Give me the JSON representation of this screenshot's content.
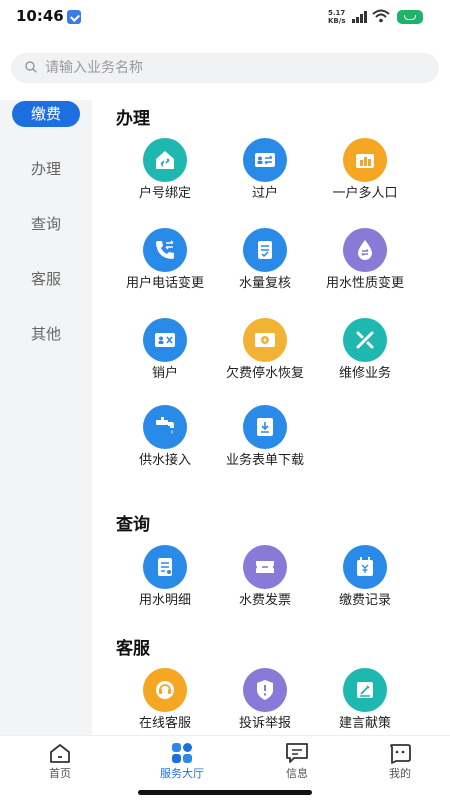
{
  "status_bar": {
    "time": "10:46",
    "speed_top": "5.17",
    "speed_bottom": "KB/s"
  },
  "search": {
    "placeholder": "请输入业务名称"
  },
  "sidebar": {
    "items": [
      {
        "label": "缴费",
        "active": true
      },
      {
        "label": "办理"
      },
      {
        "label": "查询"
      },
      {
        "label": "客服"
      },
      {
        "label": "其他"
      }
    ]
  },
  "sections": {
    "handle": {
      "title": "办理",
      "items": [
        {
          "label": "户号绑定",
          "icon": "house-link-icon",
          "color": "#1fb8b0"
        },
        {
          "label": "过户",
          "icon": "id-transfer-icon",
          "color": "#2a8ae8"
        },
        {
          "label": "一户多人口",
          "icon": "household-members-icon",
          "color": "#f5a623"
        },
        {
          "label": "用户电话变更",
          "icon": "phone-change-icon",
          "color": "#2a8ae8"
        },
        {
          "label": "水量复核",
          "icon": "water-review-icon",
          "color": "#2a8ae8"
        },
        {
          "label": "用水性质变更",
          "icon": "water-drop-change-icon",
          "color": "#8a7ad8"
        },
        {
          "label": "销户",
          "icon": "account-cancel-icon",
          "color": "#2a8ae8"
        },
        {
          "label": "欠费停水恢复",
          "icon": "arrears-restore-icon",
          "color": "#f2b233"
        },
        {
          "label": "维修业务",
          "icon": "repair-tools-icon",
          "color": "#1fb8b0"
        },
        {
          "label": "供水接入",
          "icon": "water-tap-icon",
          "color": "#2a8ae8"
        },
        {
          "label": "业务表单下载",
          "icon": "download-form-icon",
          "color": "#2a8ae8"
        }
      ]
    },
    "query": {
      "title": "查询",
      "items": [
        {
          "label": "用水明细",
          "icon": "water-detail-icon",
          "color": "#2a8ae8"
        },
        {
          "label": "水费发票",
          "icon": "invoice-ticket-icon",
          "color": "#8a7ad8"
        },
        {
          "label": "缴费记录",
          "icon": "payment-record-icon",
          "color": "#2a8ae8"
        }
      ]
    },
    "service": {
      "title": "客服",
      "items": [
        {
          "label": "在线客服",
          "icon": "online-service-icon",
          "color": "#f5a623"
        },
        {
          "label": "投诉举报",
          "icon": "complaint-shield-icon",
          "color": "#8a7ad8"
        },
        {
          "label": "建言献策",
          "icon": "suggestion-edit-icon",
          "color": "#1fb8b0"
        }
      ]
    }
  },
  "bottom_nav": {
    "items": [
      {
        "label": "首页",
        "icon": "home-icon"
      },
      {
        "label": "服务大厅",
        "icon": "grid-apps-icon",
        "active": true
      },
      {
        "label": "信息",
        "icon": "message-icon"
      },
      {
        "label": "我的",
        "icon": "profile-face-icon"
      }
    ]
  }
}
